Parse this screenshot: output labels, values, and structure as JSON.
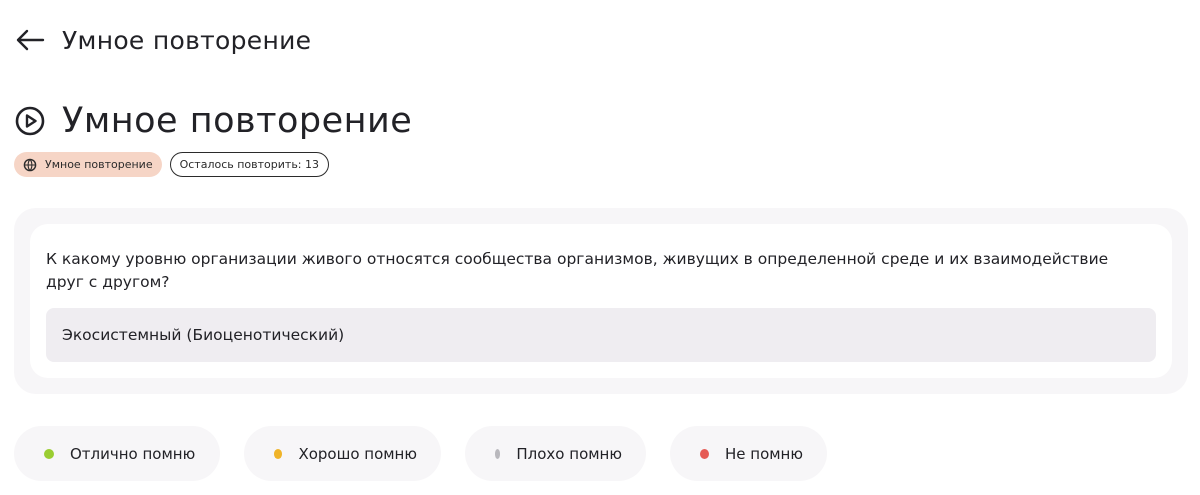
{
  "header": {
    "title": "Умное повторение",
    "back_icon": "arrow-left-icon"
  },
  "page": {
    "title": "Умное повторение",
    "title_icon": "play-circle-icon"
  },
  "chips": {
    "mode_label": "Умное повторение",
    "mode_icon": "globe-icon",
    "mode_color": "#f6d5c6",
    "remaining_label": "Осталось повторить: 13"
  },
  "card": {
    "question": "К какому уровню организации живого относятся сообщества организмов, живущих в определенной среде и их взаимодействие друг с другом?",
    "answer": "Экосистемный (Биоценотический)"
  },
  "ratings": [
    {
      "label": "Отлично помню",
      "color": "#9acd32"
    },
    {
      "label": "Хорошо помню",
      "color": "#f0b429"
    },
    {
      "label": "Плохо помню",
      "color": "#b9b8bd"
    },
    {
      "label": "Не помню",
      "color": "#e55b55"
    }
  ]
}
